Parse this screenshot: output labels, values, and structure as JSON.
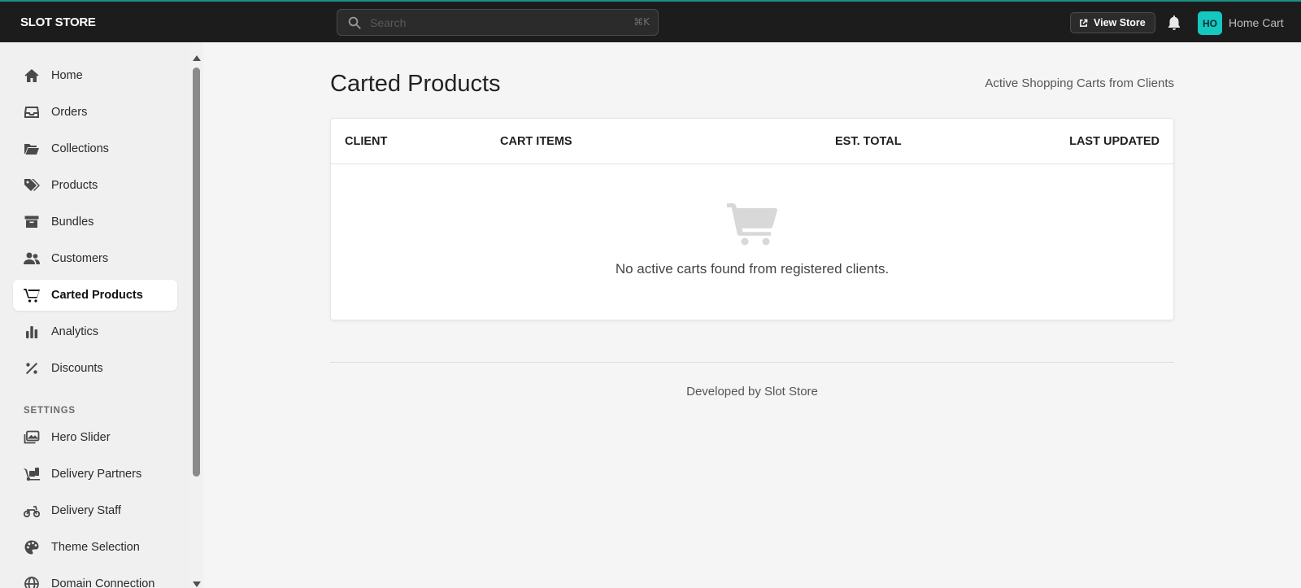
{
  "app": {
    "brand": "SLOT STORE"
  },
  "topbar": {
    "search": {
      "placeholder": "Search",
      "shortcut": "⌘K"
    },
    "view_store_label": "View Store",
    "account": {
      "initials": "HO",
      "name": "Home Cart"
    }
  },
  "sidebar": {
    "items": [
      {
        "label": "Home",
        "icon": "home-icon"
      },
      {
        "label": "Orders",
        "icon": "inbox-icon"
      },
      {
        "label": "Collections",
        "icon": "folder-open-icon"
      },
      {
        "label": "Products",
        "icon": "tags-icon"
      },
      {
        "label": "Bundles",
        "icon": "archive-box-icon"
      },
      {
        "label": "Customers",
        "icon": "users-icon"
      },
      {
        "label": "Carted Products",
        "icon": "cart-icon",
        "active": true
      },
      {
        "label": "Analytics",
        "icon": "bar-chart-icon"
      },
      {
        "label": "Discounts",
        "icon": "percent-icon"
      }
    ],
    "settings_label": "SETTINGS",
    "settings_items": [
      {
        "label": "Hero Slider",
        "icon": "images-icon"
      },
      {
        "label": "Delivery Partners",
        "icon": "dolly-icon"
      },
      {
        "label": "Delivery Staff",
        "icon": "motorcycle-icon"
      },
      {
        "label": "Theme Selection",
        "icon": "palette-icon"
      },
      {
        "label": "Domain Connection",
        "icon": "globe-icon"
      }
    ]
  },
  "main": {
    "title": "Carted Products",
    "subtitle": "Active Shopping Carts from Clients",
    "table": {
      "columns": [
        "CLIENT",
        "CART ITEMS",
        "EST. TOTAL",
        "LAST UPDATED"
      ],
      "rows": [],
      "empty_message": "No active carts found from registered clients."
    },
    "footer": "Developed by Slot Store"
  },
  "colors": {
    "topbar": "#1c1c1c",
    "accent": "#14c8c0",
    "background": "#f5f5f5"
  }
}
